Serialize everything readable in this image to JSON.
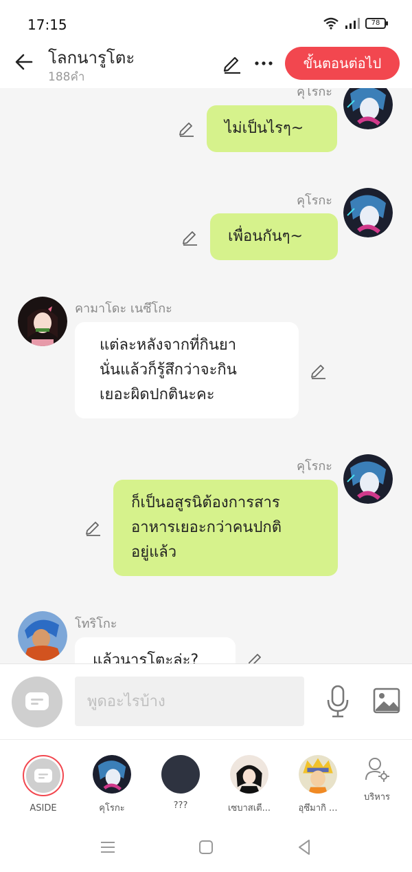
{
  "status": {
    "time": "17:15",
    "battery": "78"
  },
  "header": {
    "title": "โลกนารูโตะ",
    "word_count": "188คำ",
    "next_button": "ขั้นตอนต่อไป"
  },
  "messages": [
    {
      "speaker": "คุโรกะ",
      "text": "ไม่เป็นไรๆ~",
      "side": "right"
    },
    {
      "speaker": "คุโรกะ",
      "text": "เพื่อนกันๆ~",
      "side": "right"
    },
    {
      "speaker": "คามาโดะ เนซึโกะ",
      "lines": [
        "แต่ละหลังจากที่กินยา",
        "นั่นแล้วก็รู้สึกว่าจะกิน",
        "เยอะผิดปกตินะคะ"
      ],
      "side": "left"
    },
    {
      "speaker": "คุโรกะ",
      "lines": [
        "ก็เป็นอสูรนิต้องการสาร",
        "อาหารเยอะกว่าคนปกติ",
        "อยู่แล้ว"
      ],
      "side": "right"
    },
    {
      "speaker": "โทริโกะ",
      "text": "แล้วนารูโตะล่ะ?",
      "side": "left"
    }
  ],
  "composer": {
    "placeholder": "พูดอะไรบ้าง"
  },
  "characters": [
    {
      "label": "ASIDE"
    },
    {
      "label": "คุโรกะ"
    },
    {
      "label": "???"
    },
    {
      "label": "เซบาสเตี..."
    },
    {
      "label": "อุซึมากิ ..."
    },
    {
      "label": "บริหาร"
    }
  ],
  "colors": {
    "accent": "#f2474f",
    "my_bubble": "#d6f28c",
    "other_bubble": "#ffffff"
  }
}
